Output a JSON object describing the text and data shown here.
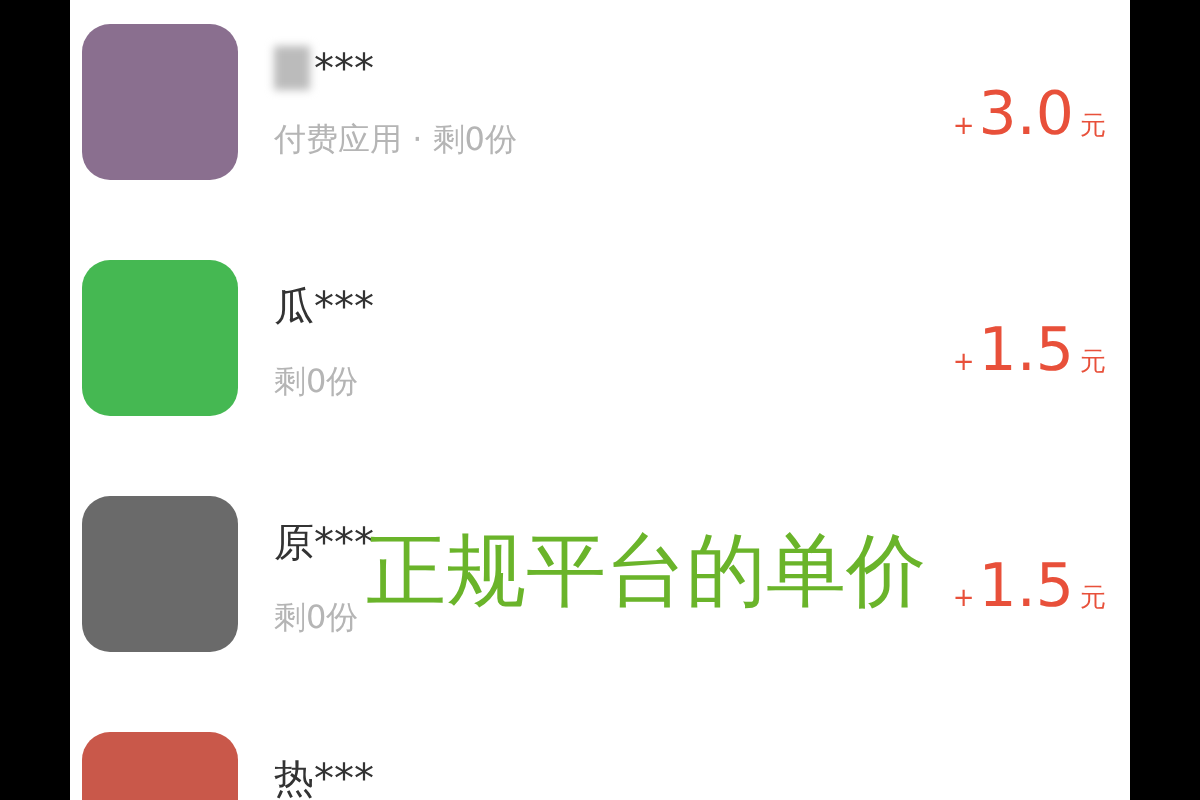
{
  "items": [
    {
      "name": "***",
      "name_blurred": true,
      "detail": "付费应用 · 剩0份",
      "color": "#8a6f8f",
      "price": {
        "sign": "+",
        "amount": "3.0",
        "unit": "元"
      }
    },
    {
      "name": "瓜***",
      "name_blurred": false,
      "detail": "剩0份",
      "color": "#45b852",
      "price": {
        "sign": "+",
        "amount": "1.5",
        "unit": "元"
      }
    },
    {
      "name": "原***",
      "name_blurred": false,
      "detail": "剩0份",
      "color": "#6a6a6a",
      "price": {
        "sign": "+",
        "amount": "1.5",
        "unit": "元"
      }
    },
    {
      "name": "热***",
      "name_blurred": false,
      "color": "#c9584a"
    }
  ],
  "caption": "正规平台的单价"
}
